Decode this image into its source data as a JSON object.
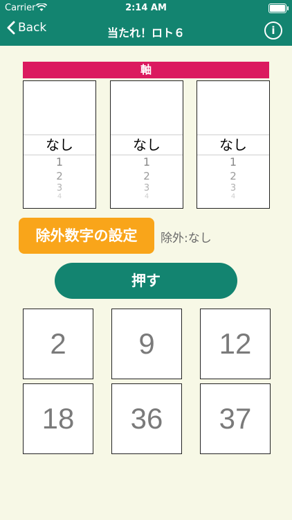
{
  "status": {
    "carrier": "Carrier",
    "time": "2:14 AM"
  },
  "nav": {
    "back_label": "Back",
    "title": "当たれ！ロト６",
    "info_icon": "i"
  },
  "axis": {
    "label": "軸"
  },
  "pickers": [
    {
      "selected": "なし",
      "options": [
        "1",
        "2",
        "3",
        "4"
      ]
    },
    {
      "selected": "なし",
      "options": [
        "1",
        "2",
        "3",
        "4"
      ]
    },
    {
      "selected": "なし",
      "options": [
        "1",
        "2",
        "3",
        "4"
      ]
    }
  ],
  "exclude": {
    "button_label": "除外数字の設定",
    "status": "除外:なし"
  },
  "push": {
    "label": "押す"
  },
  "results": [
    "2",
    "9",
    "12",
    "18",
    "36",
    "37"
  ],
  "colors": {
    "header": "#138470",
    "axis": "#db1a5f",
    "exclude_button": "#f9a51a",
    "background": "#f7f8e6"
  }
}
